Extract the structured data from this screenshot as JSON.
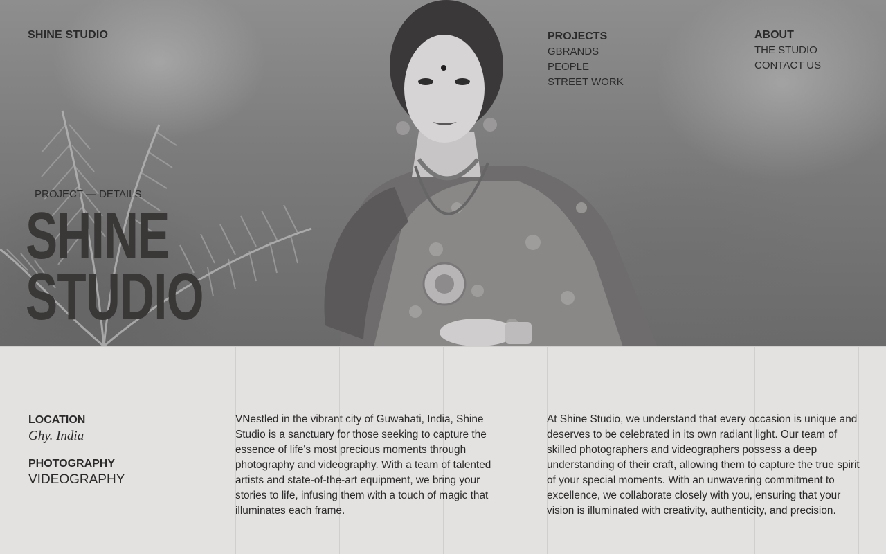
{
  "header": {
    "brand": "SHINE STUDIO",
    "projects": {
      "title": "PROJECTS",
      "links": [
        "GBRANDS",
        "PEOPLE",
        "STREET WORK"
      ]
    },
    "about": {
      "title": "ABOUT",
      "links": [
        "THE STUDIO",
        "CONTACT US"
      ]
    }
  },
  "hero": {
    "eyebrow": "PROJECT — DETAILS",
    "title_line1": "SHINE",
    "title_line2": "STUDIO"
  },
  "details": {
    "location_label": "LOCATION",
    "location_value": "Ghy. India",
    "service_label": "PHOTOGRAPHY",
    "service_value": "VIDEOGRAPHY"
  },
  "body": {
    "paragraph1": "VNestled in the vibrant city of Guwahati, India, Shine Studio is a sanctuary for those seeking to capture the essence of life's most precious moments through photography and videography. With a team of talented artists and state-of-the-art equipment, we bring your stories to life, infusing them with a touch of magic that illuminates each frame.",
    "paragraph2": "At Shine Studio, we understand that every occasion is unique and deserves to be celebrated in its own radiant light. Our team of skilled photographers and videographers possess a deep understanding of their craft, allowing them to capture the true spirit of your special moments. With an unwavering commitment to excellence, we collaborate closely with you, ensuring that your vision is illuminated with creativity, authenticity, and precision."
  },
  "colors": {
    "background": "#e3e2e0",
    "text": "#2b2a2a",
    "hero_title": "#3a3737"
  }
}
